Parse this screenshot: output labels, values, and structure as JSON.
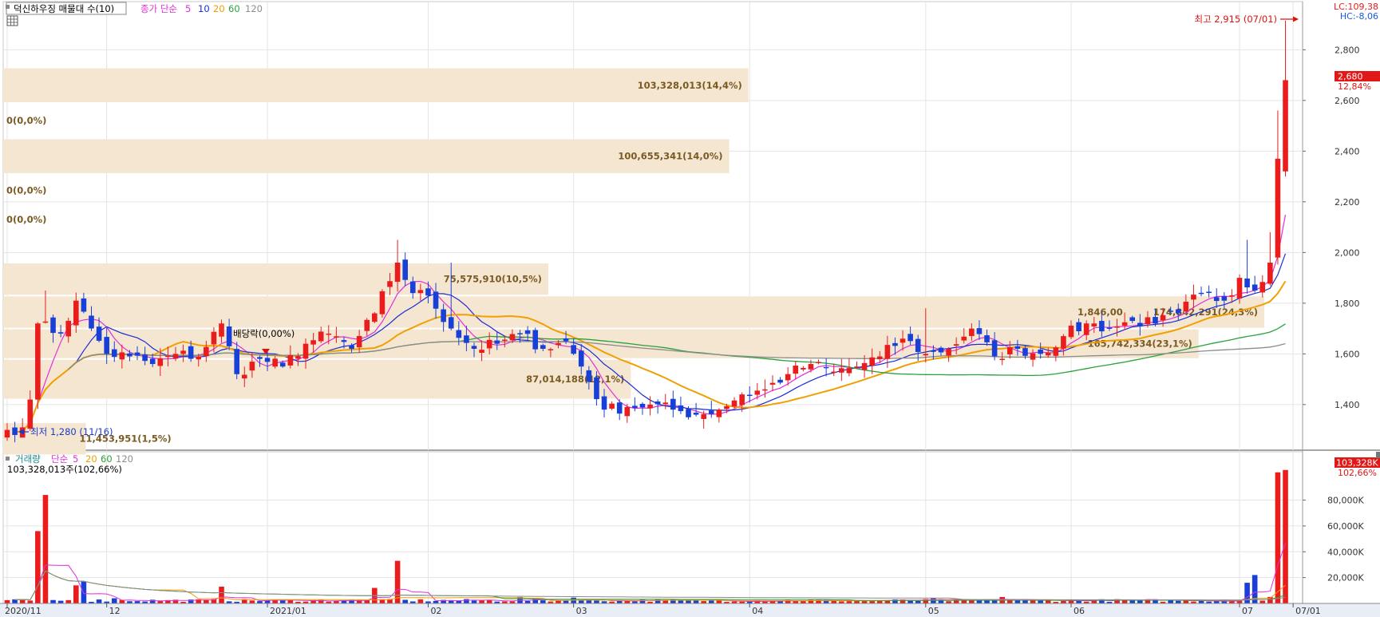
{
  "legend": {
    "title": "덕신하우징 매물대 수(10)",
    "ma_label": "종가 단순",
    "periods": [
      "5",
      "10",
      "20",
      "60",
      "120"
    ],
    "vol_title": "거래량",
    "vol_ma_label": "단순",
    "vol_periods": [
      "5",
      "20",
      "60",
      "120"
    ],
    "vol_value": "103,328,013주(102,66%)"
  },
  "colors": {
    "up": "#ea1c1c",
    "down": "#1840d8",
    "ma5": "#e22fd9",
    "ma10": "#1b2bd6",
    "ma20": "#f0a000",
    "ma60": "#2aa13a",
    "ma120": "#8c8c8c",
    "band": "#f5e6d2",
    "label": "#7a5a20"
  },
  "indicators": {
    "lc": "LC:109,38",
    "hc": "HC:-8,06"
  },
  "price_box": {
    "price": "2,680",
    "pct": "12,84%"
  },
  "vol_box": {
    "value": "103,328K",
    "pct": "102,66%"
  },
  "annotations": {
    "high": "최고 2,915 (07/01)",
    "low": "최저 1,280 (11/16)",
    "dividend": "배당락(0,00%)"
  },
  "chart_data": {
    "type": "candlestick",
    "title": "덕신하우징 매물대 수(10)",
    "period": "2020/11 - 2021/07",
    "x_ticks": [
      {
        "i": 0,
        "label": "2020/11"
      },
      {
        "i": 13,
        "label": "12"
      },
      {
        "i": 34,
        "label": "2021/01"
      },
      {
        "i": 55,
        "label": "02"
      },
      {
        "i": 74,
        "label": "03"
      },
      {
        "i": 97,
        "label": "04"
      },
      {
        "i": 120,
        "label": "05"
      },
      {
        "i": 139,
        "label": "06"
      },
      {
        "i": 161,
        "label": "07"
      },
      {
        "i": 168,
        "label": "07/01"
      }
    ],
    "price_ylim": [
      1220,
      2990
    ],
    "price_ticks": [
      1400,
      1600,
      1800,
      2000,
      2200,
      2400,
      2600,
      2800
    ],
    "price_tick_labels": [
      "1,400",
      "1,600",
      "1,800",
      "2,000",
      "2,200",
      "2,400",
      "2,600",
      "2,800"
    ],
    "volume_ylim": [
      0,
      110000
    ],
    "volume_ticks": [
      20000,
      40000,
      60000,
      80000
    ],
    "volume_tick_labels": [
      "20,000K",
      "40,000K",
      "60,000K",
      "80,000K"
    ],
    "volume_profile": [
      {
        "lo": 1200,
        "hi": 1330,
        "vol": 11453951,
        "label": "11,453,951(1,5%)"
      },
      {
        "lo": 1420,
        "hi": 1580,
        "vol": 87014188,
        "label": "87,014,188(12,1%)"
      },
      {
        "lo": 1580,
        "hi": 1700,
        "vol": 165742334,
        "label": "165,742,334(23,1%)"
      },
      {
        "lo": 1700,
        "hi": 1830,
        "vol": 174842291,
        "label": "174,842,291(24,3%)"
      },
      {
        "lo": 1830,
        "hi": 1960,
        "vol": 75575910,
        "label": "75,575,910(10,5%)"
      },
      {
        "lo": 2080,
        "hi": 2180,
        "vol": 0,
        "label": "0(0,0%)"
      },
      {
        "lo": 2180,
        "hi": 2310,
        "vol": 0,
        "label": "0(0,0%)"
      },
      {
        "lo": 2310,
        "hi": 2450,
        "vol": 100655341,
        "label": "100,655,341(14,0%)"
      },
      {
        "lo": 2450,
        "hi": 2590,
        "vol": 0,
        "label": "0(0,0%)"
      },
      {
        "lo": 2590,
        "hi": 2730,
        "vol": 103328013,
        "label": "103,328,013(14,4%)"
      }
    ],
    "current_price_label": "1,846,00",
    "ma_last": {
      "ma5": 2140,
      "ma10": 1985,
      "ma20": 1855,
      "ma60": 1680,
      "ma120": 1625
    },
    "close_anchors": [
      [
        0,
        1300
      ],
      [
        2,
        1310
      ],
      [
        3,
        1420
      ],
      [
        4,
        1720
      ],
      [
        7,
        1680
      ],
      [
        9,
        1810
      ],
      [
        11,
        1700
      ],
      [
        13,
        1600
      ],
      [
        16,
        1590
      ],
      [
        19,
        1560
      ],
      [
        22,
        1600
      ],
      [
        25,
        1590
      ],
      [
        28,
        1720
      ],
      [
        30,
        1520
      ],
      [
        33,
        1580
      ],
      [
        36,
        1550
      ],
      [
        39,
        1640
      ],
      [
        42,
        1680
      ],
      [
        45,
        1620
      ],
      [
        48,
        1760
      ],
      [
        51,
        1960
      ],
      [
        53,
        1840
      ],
      [
        55,
        1830
      ],
      [
        58,
        1700
      ],
      [
        61,
        1620
      ],
      [
        64,
        1640
      ],
      [
        67,
        1680
      ],
      [
        70,
        1620
      ],
      [
        73,
        1650
      ],
      [
        75,
        1550
      ],
      [
        78,
        1380
      ],
      [
        81,
        1390
      ],
      [
        84,
        1400
      ],
      [
        87,
        1380
      ],
      [
        90,
        1360
      ],
      [
        93,
        1380
      ],
      [
        96,
        1440
      ],
      [
        99,
        1460
      ],
      [
        102,
        1520
      ],
      [
        105,
        1560
      ],
      [
        108,
        1530
      ],
      [
        111,
        1550
      ],
      [
        114,
        1590
      ],
      [
        117,
        1660
      ],
      [
        120,
        1600
      ],
      [
        123,
        1620
      ],
      [
        126,
        1700
      ],
      [
        129,
        1590
      ],
      [
        132,
        1620
      ],
      [
        135,
        1600
      ],
      [
        138,
        1670
      ],
      [
        141,
        1720
      ],
      [
        144,
        1700
      ],
      [
        147,
        1730
      ],
      [
        150,
        1720
      ],
      [
        153,
        1760
      ],
      [
        156,
        1840
      ],
      [
        159,
        1810
      ],
      [
        161,
        1900
      ],
      [
        163,
        1850
      ],
      [
        165,
        1960
      ],
      [
        166,
        2370
      ],
      [
        167,
        2680
      ]
    ],
    "volume_spikes": [
      [
        4,
        56000
      ],
      [
        5,
        84000
      ],
      [
        9,
        14000
      ],
      [
        10,
        17000
      ],
      [
        14,
        4000
      ],
      [
        28,
        13000
      ],
      [
        48,
        12000
      ],
      [
        51,
        33000
      ],
      [
        67,
        5000
      ],
      [
        74,
        4500
      ],
      [
        121,
        4000
      ],
      [
        130,
        5000
      ],
      [
        162,
        16000
      ],
      [
        163,
        22000
      ],
      [
        165,
        5000
      ],
      [
        166,
        101500
      ],
      [
        167,
        103300
      ]
    ],
    "series": [
      {
        "name": "종가 단순 5",
        "type": "ma"
      },
      {
        "name": "10",
        "type": "ma"
      },
      {
        "name": "20",
        "type": "ma"
      },
      {
        "name": "60",
        "type": "ma"
      },
      {
        "name": "120",
        "type": "ma"
      }
    ]
  }
}
